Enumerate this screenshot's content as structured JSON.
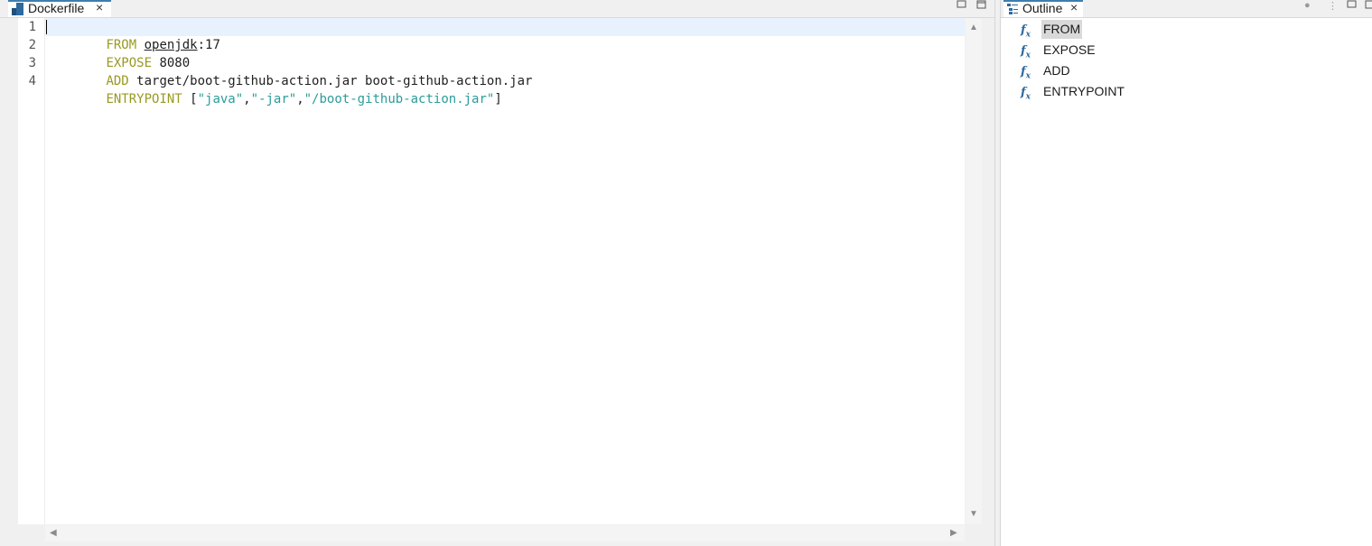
{
  "editor": {
    "tab_label": "Dockerfile",
    "close_glyph": "×",
    "lines": [
      {
        "num": "1",
        "tokens": [
          {
            "text": "FROM",
            "style": "kw"
          },
          {
            "text": " ",
            "style": ""
          },
          {
            "text": "openjdk",
            "style": "ul"
          },
          {
            "text": ":17",
            "style": ""
          }
        ]
      },
      {
        "num": "2",
        "tokens": [
          {
            "text": "EXPOSE",
            "style": "kw"
          },
          {
            "text": " 8080",
            "style": ""
          }
        ]
      },
      {
        "num": "3",
        "tokens": [
          {
            "text": "ADD",
            "style": "kw"
          },
          {
            "text": " target/boot-github-action.jar boot-github-action.jar",
            "style": ""
          }
        ]
      },
      {
        "num": "4",
        "tokens": [
          {
            "text": "ENTRYPOINT",
            "style": "kw"
          },
          {
            "text": " [",
            "style": ""
          },
          {
            "text": "\"java\"",
            "style": "str"
          },
          {
            "text": ",",
            "style": ""
          },
          {
            "text": "\"-jar\"",
            "style": "str"
          },
          {
            "text": ",",
            "style": ""
          },
          {
            "text": "\"/boot-github-action.jar\"",
            "style": "str"
          },
          {
            "text": "]",
            "style": ""
          }
        ]
      }
    ],
    "current_line": 1
  },
  "outline": {
    "tab_label": "Outline",
    "close_glyph": "×",
    "items": [
      {
        "label": "FROM",
        "icon": "function-icon",
        "selected": true
      },
      {
        "label": "EXPOSE",
        "icon": "function-icon",
        "selected": false
      },
      {
        "label": "ADD",
        "icon": "function-icon",
        "selected": false
      },
      {
        "label": "ENTRYPOINT",
        "icon": "function-icon",
        "selected": false
      }
    ]
  },
  "colors": {
    "keyword": "#999922",
    "string": "#2a9d9a",
    "current_line_bg": "#e8f2fe",
    "active_tab_accent": "#3c7fb1",
    "icon_blue": "#2d6a9e"
  }
}
